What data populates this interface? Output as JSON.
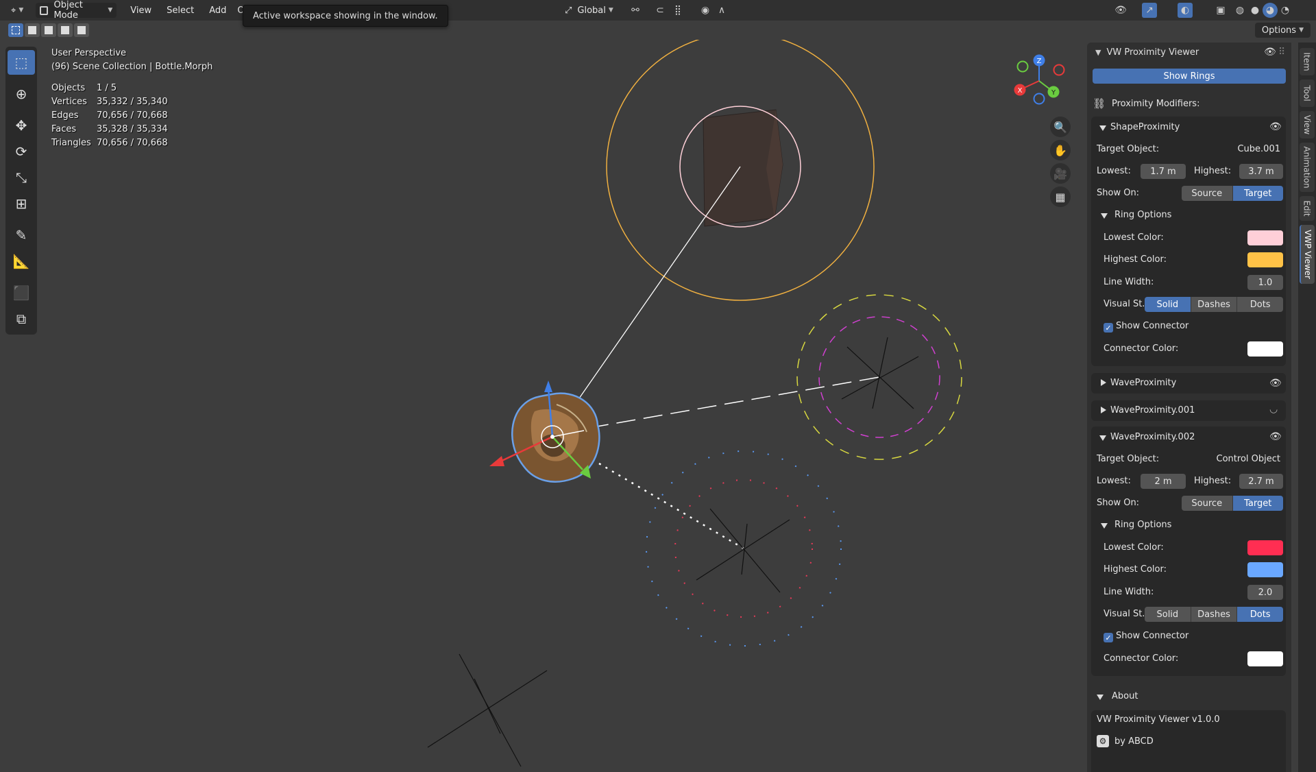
{
  "header": {
    "mode": "Object Mode",
    "menu": [
      "View",
      "Select",
      "Add",
      "Obj"
    ],
    "tooltip": "Active workspace showing in the window.",
    "transform_orientation": "Global",
    "options": "Options"
  },
  "viewport": {
    "perspective": "User Perspective",
    "collection": "(96) Scene Collection | Bottle.Morph",
    "stats": [
      {
        "key": "Objects",
        "value": "1 / 5"
      },
      {
        "key": "Vertices",
        "value": "35,332 / 35,340"
      },
      {
        "key": "Edges",
        "value": "70,656 / 70,668"
      },
      {
        "key": "Faces",
        "value": "35,328 / 35,334"
      },
      {
        "key": "Triangles",
        "value": "70,656 / 70,668"
      }
    ],
    "gizmo": {
      "x": "X",
      "y": "Y",
      "z": "Z"
    }
  },
  "panel": {
    "title": "VW Proximity Viewer",
    "show_rings": "Show Rings",
    "modifiers_label": "Proximity Modifiers:",
    "mod1": {
      "name": "ShapeProximity",
      "target_label": "Target Object:",
      "target": "Cube.001",
      "lowest_label": "Lowest:",
      "lowest": "1.7 m",
      "highest_label": "Highest:",
      "highest": "3.7 m",
      "show_on_label": "Show On:",
      "show_on": [
        "Source",
        "Target"
      ],
      "ring_options": "Ring Options",
      "lowest_color_label": "Lowest Color:",
      "lowest_color": "#ffcfd8",
      "highest_color_label": "Highest Color:",
      "highest_color": "#ffc247",
      "line_width_label": "Line Width:",
      "line_width": "1.0",
      "visual_style_label": "Visual St...",
      "visual_style": [
        "Solid",
        "Dashes",
        "Dots"
      ],
      "show_connector": "Show Connector",
      "connector_color_label": "Connector Color:",
      "connector_color": "#ffffff"
    },
    "mod2": {
      "name": "WaveProximity"
    },
    "mod3": {
      "name": "WaveProximity.001"
    },
    "mod4": {
      "name": "WaveProximity.002",
      "target_label": "Target Object:",
      "target": "Control Object",
      "lowest_label": "Lowest:",
      "lowest": "2 m",
      "highest_label": "Highest:",
      "highest": "2.7 m",
      "show_on_label": "Show On:",
      "show_on": [
        "Source",
        "Target"
      ],
      "ring_options": "Ring Options",
      "lowest_color_label": "Lowest Color:",
      "lowest_color": "#ff2e52",
      "highest_color_label": "Highest Color:",
      "highest_color": "#6aa8ff",
      "line_width_label": "Line Width:",
      "line_width": "2.0",
      "visual_style_label": "Visual St...",
      "visual_style": [
        "Solid",
        "Dashes",
        "Dots"
      ],
      "show_connector": "Show Connector",
      "connector_color_label": "Connector Color:",
      "connector_color": "#ffffff"
    },
    "about": {
      "title": "About",
      "version": "VW Proximity Viewer  v1.0.0",
      "author": "by ABCD"
    }
  },
  "sidetabs": [
    "Item",
    "Tool",
    "View",
    "Animation",
    "Edit",
    "VWP Viewer"
  ]
}
